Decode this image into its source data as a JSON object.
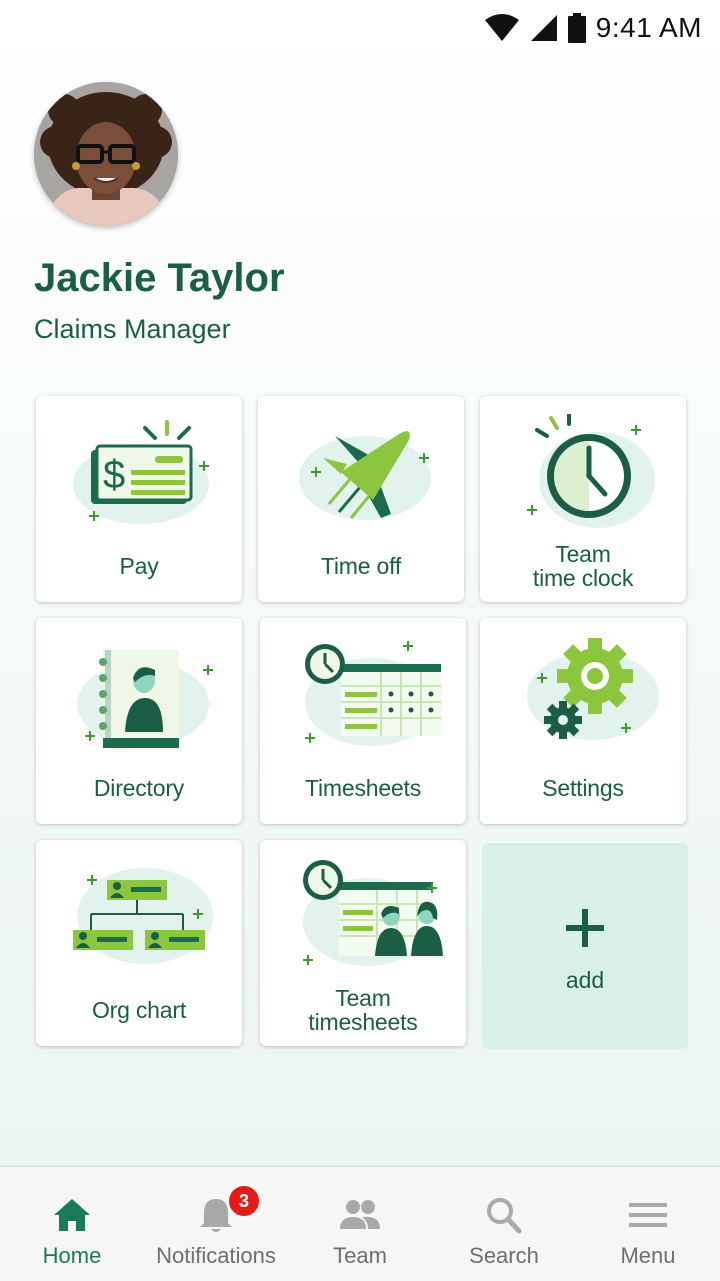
{
  "status_bar": {
    "time": "9:41 AM",
    "icons": [
      "wifi-icon",
      "cell-signal-icon",
      "battery-icon"
    ]
  },
  "profile": {
    "name": "Jackie Taylor",
    "role": "Claims Manager"
  },
  "tiles": [
    {
      "label": "Pay",
      "icon": "pay-check-icon"
    },
    {
      "label": "Time off",
      "icon": "airplane-icon"
    },
    {
      "label_lines": [
        "Team",
        "time clock"
      ],
      "icon": "clock-icon"
    },
    {
      "label": "Directory",
      "icon": "directory-book-icon"
    },
    {
      "label": "Timesheets",
      "icon": "timesheet-calendar-icon"
    },
    {
      "label": "Settings",
      "icon": "gear-icon"
    },
    {
      "label": "Org chart",
      "icon": "org-chart-icon"
    },
    {
      "label_lines": [
        "Team",
        "timesheets"
      ],
      "icon": "team-timesheet-icon"
    }
  ],
  "add_tile": {
    "label": "add",
    "icon": "plus-icon"
  },
  "bottom_nav": {
    "items": [
      {
        "label": "Home",
        "icon": "home-icon",
        "active": true
      },
      {
        "label": "Notifications",
        "icon": "bell-icon",
        "badge": "3"
      },
      {
        "label": "Team",
        "icon": "people-icon"
      },
      {
        "label": "Search",
        "icon": "search-icon"
      },
      {
        "label": "Menu",
        "icon": "hamburger-menu-icon"
      }
    ]
  },
  "colors": {
    "primary_dark": "#1b5e45",
    "accent_green": "#8cc63f",
    "light_green": "#d9efe9",
    "badge_red": "#e31b1b",
    "nav_inactive": "#6f6f6f"
  }
}
